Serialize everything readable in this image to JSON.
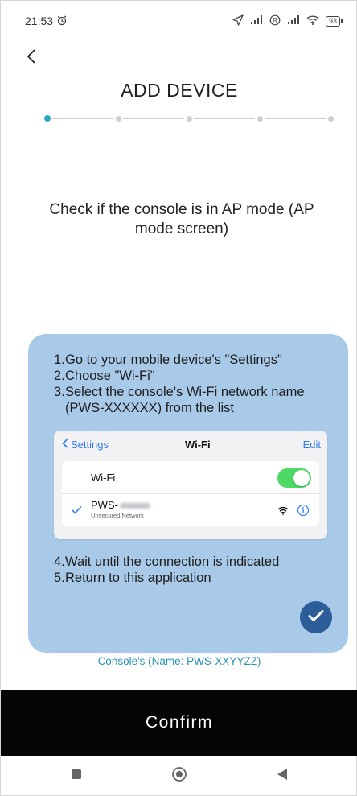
{
  "status_bar": {
    "time": "21:53",
    "battery": "93"
  },
  "header": {
    "title": "ADD DEVICE"
  },
  "stepper": {
    "total_steps": 5,
    "current_step": 1
  },
  "instruction": {
    "text": "Check if the console is in AP mode (AP mode screen)"
  },
  "info_card": {
    "steps_top": [
      {
        "num": "1.",
        "text": "Go to your mobile device's \"Settings\""
      },
      {
        "num": "2.",
        "text": "Choose \"Wi-Fi\""
      },
      {
        "num": "3.",
        "text": "Select the console's Wi-Fi network name (PWS-XXXXXX) from the list"
      }
    ],
    "wifi_mock": {
      "back_label": "Settings",
      "title": "Wi-Fi",
      "edit_label": "Edit",
      "wifi_row_label": "Wi-Fi",
      "network_prefix": "PWS-",
      "network_subtitle": "Unsecured Network"
    },
    "steps_bottom": [
      {
        "num": "4.",
        "text": "Wait until the connection is indicated"
      },
      {
        "num": "5.",
        "text": "Return to this application"
      }
    ]
  },
  "console_name": "Console's (Name: PWS-XXYYZZ)",
  "confirm_button": {
    "label": "Confirm"
  },
  "colors": {
    "accent": "#2aa7b9",
    "card_background": "#a9c9e9",
    "check_badge": "#2c5d98",
    "ios_blue": "#2f7cf6",
    "ios_green": "#4cd964",
    "confirm_bar": "#050505"
  },
  "icons": {
    "back": "chevron-left-icon",
    "alarm": "alarm-clock-icon",
    "location": "location-arrow-icon",
    "signal": "signal-icon",
    "wifi": "wifi-icon",
    "battery": "battery-icon",
    "check": "check-icon",
    "info": "info-icon",
    "nav_recent": "square-icon",
    "nav_home": "circle-icon",
    "nav_back": "triangle-left-icon"
  }
}
